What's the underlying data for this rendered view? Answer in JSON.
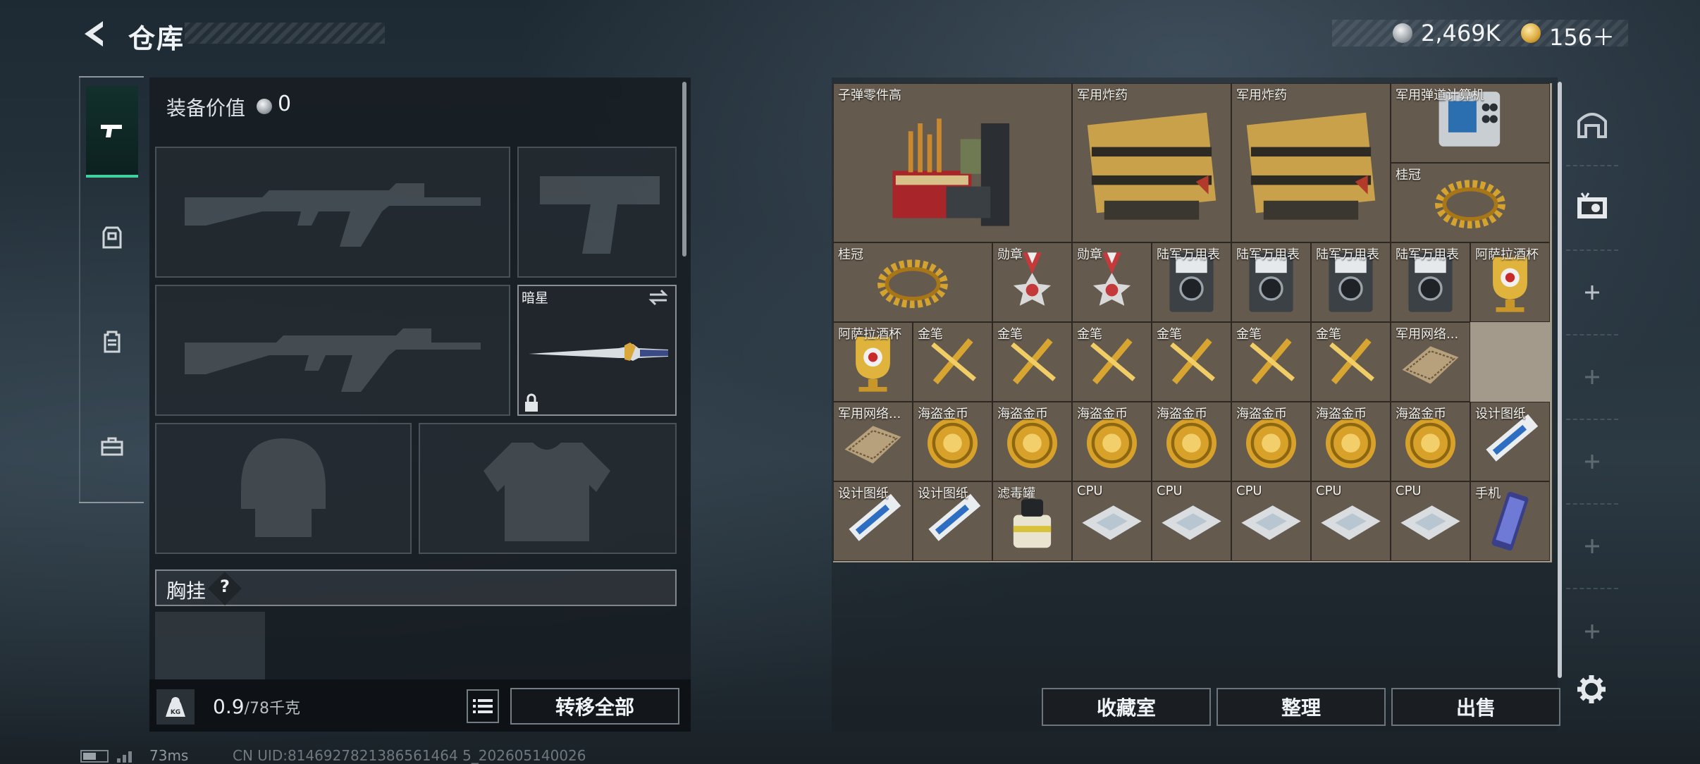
{
  "header": {
    "title": "仓库",
    "currency_silver": "2,469K",
    "currency_gold": "156＋"
  },
  "left": {
    "equip_label": "装备价值",
    "equip_value": "0",
    "melee_name": "暗星",
    "chest_label": "胸挂",
    "chest_help": "?",
    "weight_current": "0.9",
    "weight_max": "/78千克",
    "kg_badge": "KG",
    "transfer_label": "转移全部",
    "tabs": [
      "weapons-icon",
      "armor-icon",
      "backpack-icon",
      "toolbox-icon"
    ]
  },
  "stash": {
    "items": [
      {
        "label": "子弹零件高",
        "icon": "ammo-parts"
      },
      {
        "label": "军用炸药",
        "icon": "explosive-case"
      },
      {
        "label": "军用炸药",
        "icon": "explosive-case"
      },
      {
        "label": "军用弹道计算机",
        "icon": "ballistic-computer"
      },
      {
        "label": "桂冠",
        "icon": "laurel-wreath"
      },
      {
        "label": "桂冠",
        "icon": "laurel-wreath"
      },
      {
        "label": "勋章",
        "icon": "medal"
      },
      {
        "label": "勋章",
        "icon": "medal"
      },
      {
        "label": "陆军万用表",
        "icon": "multimeter"
      },
      {
        "label": "陆军万用表",
        "icon": "multimeter"
      },
      {
        "label": "陆军万用表",
        "icon": "multimeter"
      },
      {
        "label": "陆军万用表",
        "icon": "multimeter"
      },
      {
        "label": "阿萨拉酒杯",
        "icon": "goblet"
      },
      {
        "label": "阿萨拉酒杯",
        "icon": "goblet"
      },
      {
        "label": "金笔",
        "icon": "gold-pen"
      },
      {
        "label": "金笔",
        "icon": "gold-pen"
      },
      {
        "label": "金笔",
        "icon": "gold-pen"
      },
      {
        "label": "金笔",
        "icon": "gold-pen"
      },
      {
        "label": "金笔",
        "icon": "gold-pen"
      },
      {
        "label": "金笔",
        "icon": "gold-pen"
      },
      {
        "label": "军用网络...",
        "icon": "network-module"
      },
      {
        "label": "军用网络...",
        "icon": "network-module"
      },
      {
        "label": "海盗金币",
        "icon": "pirate-coin"
      },
      {
        "label": "海盗金币",
        "icon": "pirate-coin"
      },
      {
        "label": "海盗金币",
        "icon": "pirate-coin"
      },
      {
        "label": "海盗金币",
        "icon": "pirate-coin"
      },
      {
        "label": "海盗金币",
        "icon": "pirate-coin"
      },
      {
        "label": "海盗金币",
        "icon": "pirate-coin"
      },
      {
        "label": "海盗金币",
        "icon": "pirate-coin"
      },
      {
        "label": "设计图纸",
        "icon": "blueprint"
      },
      {
        "label": "设计图纸",
        "icon": "blueprint"
      },
      {
        "label": "设计图纸",
        "icon": "blueprint"
      },
      {
        "label": "滤毒罐",
        "icon": "filter-canister"
      },
      {
        "label": "CPU",
        "icon": "cpu"
      },
      {
        "label": "CPU",
        "icon": "cpu"
      },
      {
        "label": "CPU",
        "icon": "cpu"
      },
      {
        "label": "CPU",
        "icon": "cpu"
      },
      {
        "label": "CPU",
        "icon": "cpu"
      },
      {
        "label": "手机",
        "icon": "phone"
      }
    ],
    "buttons": {
      "collection": "收藏室",
      "sort": "整理",
      "sell": "出售"
    }
  },
  "footer": {
    "ping": "73ms",
    "uid": "CN UID:8146927821386561464 5_202605140026"
  }
}
